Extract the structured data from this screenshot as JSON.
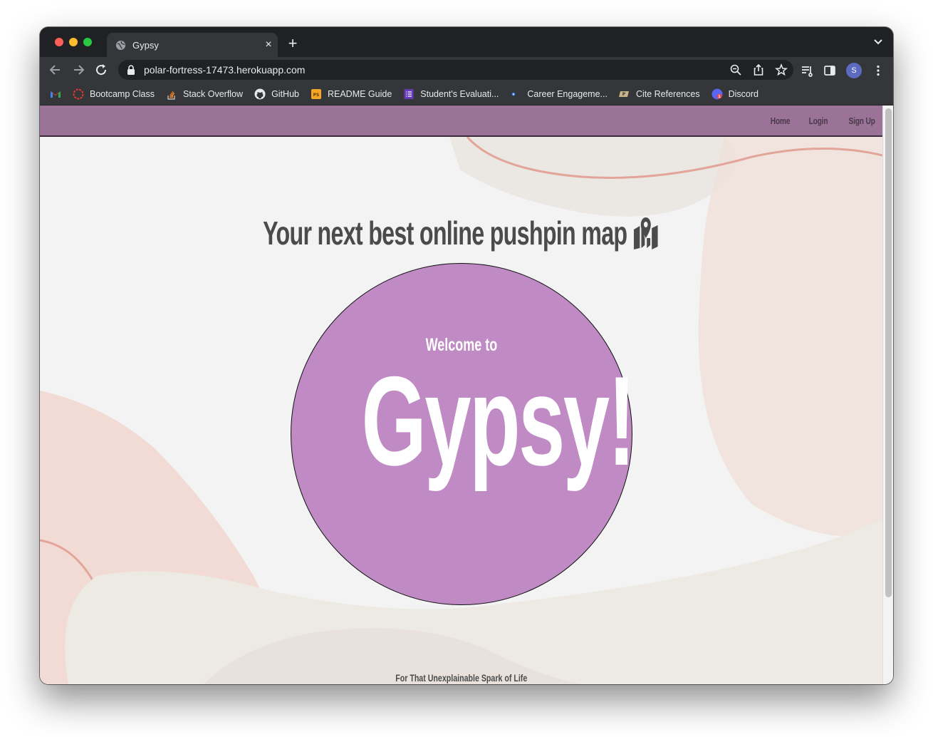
{
  "browser": {
    "tab_title": "Gypsy",
    "tab_close": "×",
    "new_tab": "+",
    "url": "polar-fortress-17473.herokuapp.com",
    "profile_initial": "S"
  },
  "bookmarks": [
    {
      "label": "",
      "icon": "gmail-icon"
    },
    {
      "label": "Bootcamp Class",
      "icon": "bootcamp-icon"
    },
    {
      "label": "Stack Overflow",
      "icon": "stackoverflow-icon"
    },
    {
      "label": "GitHub",
      "icon": "github-icon"
    },
    {
      "label": "README Guide",
      "icon": "readme-icon"
    },
    {
      "label": "Student's Evaluati...",
      "icon": "forms-icon"
    },
    {
      "label": "Career Engageme...",
      "icon": "career-icon"
    },
    {
      "label": "Cite References",
      "icon": "cite-icon"
    },
    {
      "label": "Discord",
      "icon": "discord-icon"
    }
  ],
  "page": {
    "nav": {
      "home": "Home",
      "login": "Login",
      "signup": "Sign Up"
    },
    "headline": "Your next best online pushpin map",
    "welcome": "Welcome to",
    "brand": "Gypsy!",
    "tagline": "For That Unexplainable Spark of Life"
  },
  "colors": {
    "navbar": "#9b7399",
    "circle": "#c08ac5",
    "background": "#f3f3f3",
    "accent_line": "#e3a59a"
  }
}
